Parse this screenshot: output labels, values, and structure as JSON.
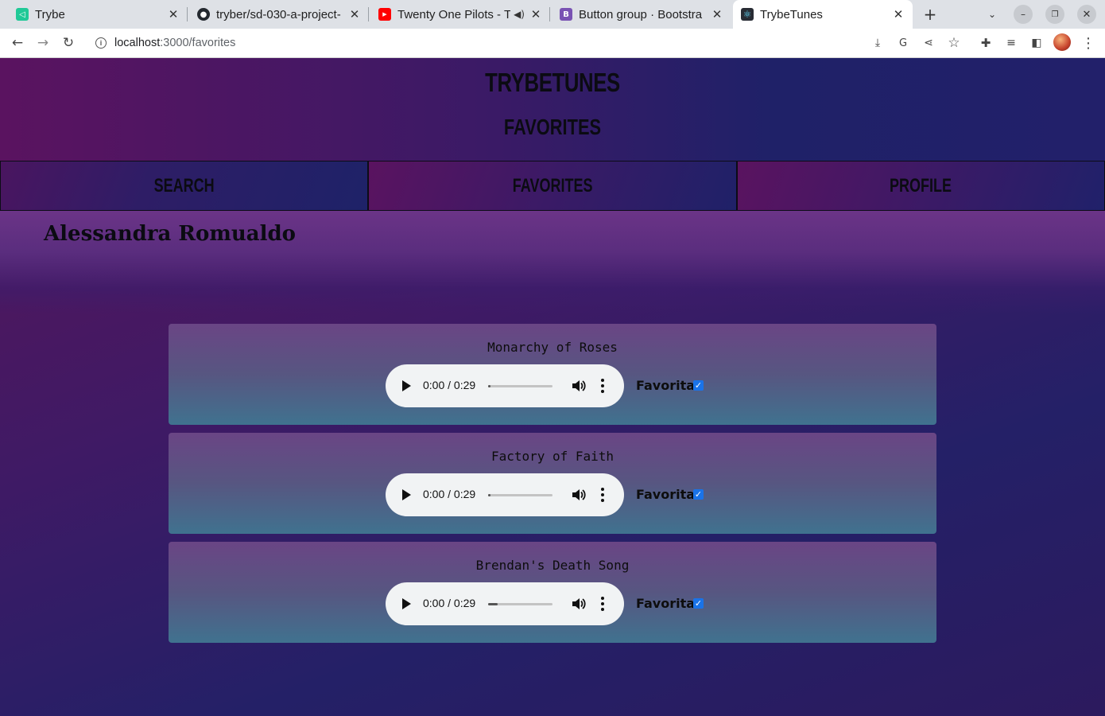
{
  "browser": {
    "tabs": [
      {
        "title": "Trybe",
        "icon": "trybe-icon",
        "color": "#20c997",
        "glyph": "◁"
      },
      {
        "title": "tryber/sd-030-a-project-",
        "icon": "github-icon",
        "color": "#24292f",
        "glyph": "●"
      },
      {
        "title": "Twenty One Pilots - Tw",
        "icon": "youtube-icon",
        "color": "#ff0000",
        "glyph": "▶"
      },
      {
        "title": "Button group · Bootstra",
        "icon": "bootstrap-icon",
        "color": "#7952b3",
        "glyph": "B"
      },
      {
        "title": "TrybeTunes",
        "icon": "react-icon",
        "color": "#282c34",
        "glyph": "⚛"
      }
    ],
    "url_host": "localhost",
    "url_path": ":3000/favorites"
  },
  "app": {
    "brand": "TRYBETUNES",
    "page_title": "FAVORITES",
    "nav": {
      "search": "SEARCH",
      "favorites": "FAVORITES",
      "profile": "PROFILE"
    },
    "user_name": "Alessandra Romualdo"
  },
  "songs": [
    {
      "name": "Monarchy of Roses",
      "time": "0:00 / 0:29",
      "favorite_label": "Favorita",
      "favorited": true,
      "buffered": 0.04
    },
    {
      "name": "Factory of Faith",
      "time": "0:00 / 0:29",
      "favorite_label": "Favorita",
      "favorited": true,
      "buffered": 0.04
    },
    {
      "name": "Brendan's Death Song",
      "time": "0:00 / 0:29",
      "favorite_label": "Favorita",
      "favorited": true,
      "buffered": 0.15
    }
  ]
}
